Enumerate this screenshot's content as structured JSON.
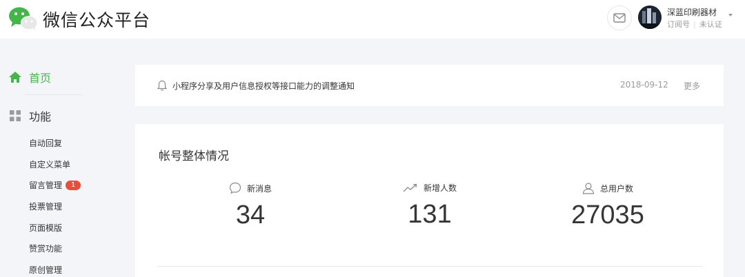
{
  "header": {
    "brand_title": "微信公众平台",
    "account": {
      "name": "深蓝印刷器材",
      "type": "订阅号",
      "verify_status": "未认证"
    }
  },
  "sidebar": {
    "home_label": "首页",
    "functions_label": "功能",
    "sub_items": [
      {
        "label": "自动回复"
      },
      {
        "label": "自定义菜单"
      },
      {
        "label": "留言管理",
        "badge": "1"
      },
      {
        "label": "投票管理"
      },
      {
        "label": "页面模版"
      },
      {
        "label": "赞赏功能"
      },
      {
        "label": "原创管理"
      }
    ]
  },
  "notice": {
    "title": "小程序分享及用户信息授权等接口能力的调整通知",
    "date": "2018-09-12",
    "more_label": "更多"
  },
  "overview": {
    "heading": "帐号整体情况",
    "stats": [
      {
        "label": "新消息",
        "value": "34",
        "icon": "message-icon"
      },
      {
        "label": "新增人数",
        "value": "131",
        "icon": "trend-icon"
      },
      {
        "label": "总用户数",
        "value": "27035",
        "icon": "user-icon"
      }
    ]
  },
  "colors": {
    "brand_green": "#44b549",
    "badge_red": "#e94e3a",
    "page_bg": "#f4f5f9"
  }
}
